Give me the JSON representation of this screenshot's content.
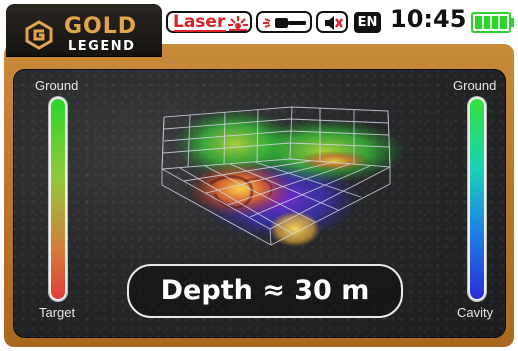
{
  "header": {
    "logo_title": "GOLD",
    "logo_subtitle": "LEGEND",
    "accent_color": "#e1a64c"
  },
  "statusbar": {
    "laser_label": "Laser",
    "laser_icon": "laser-beam-icon",
    "probe_icon": "sensor-probe-icon",
    "mute_icon": "speaker-muted-icon",
    "language": "EN",
    "time": "10:45",
    "battery_level": 1.0,
    "battery_color": "#2fd12f"
  },
  "scan": {
    "left_scale": {
      "top_label": "Ground",
      "bottom_label": "Target"
    },
    "right_scale": {
      "top_label": "Ground",
      "bottom_label": "Cavity"
    },
    "depth_text": "Depth ≈ 30 m"
  }
}
